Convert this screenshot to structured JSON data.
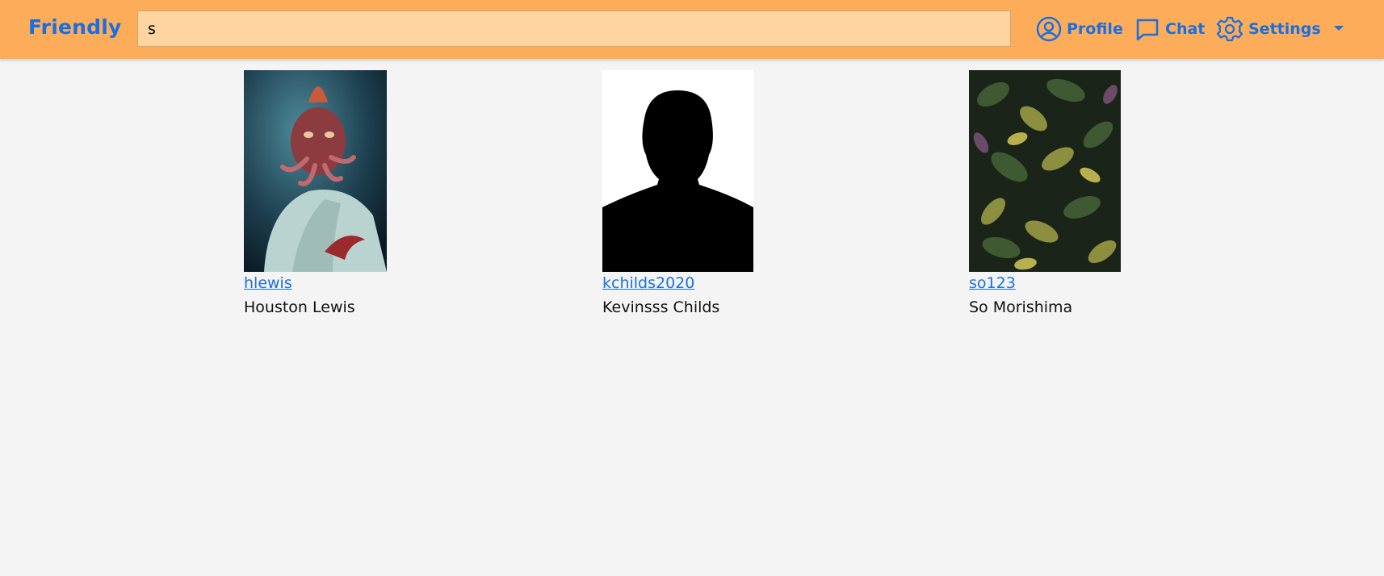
{
  "app": {
    "brand": "Friendly",
    "accent_color": "#1a6fe0",
    "navbar_color": "#fdad59"
  },
  "search": {
    "value": "s",
    "placeholder": ""
  },
  "nav": {
    "profile": {
      "label": "Profile",
      "icon": "user-circle-icon"
    },
    "chat": {
      "label": "Chat",
      "icon": "chat-bubble-icon"
    },
    "settings": {
      "label": "Settings",
      "icon": "gear-icon",
      "dropdown": true
    }
  },
  "results": [
    {
      "username": "hlewis",
      "name": "Houston Lewis",
      "image": "character-portrait"
    },
    {
      "username": "kchilds2020",
      "name": "Kevinsss Childs",
      "image": "silhouette-placeholder"
    },
    {
      "username": "so123",
      "name": "So Morishima",
      "image": "leaves-photo"
    }
  ]
}
